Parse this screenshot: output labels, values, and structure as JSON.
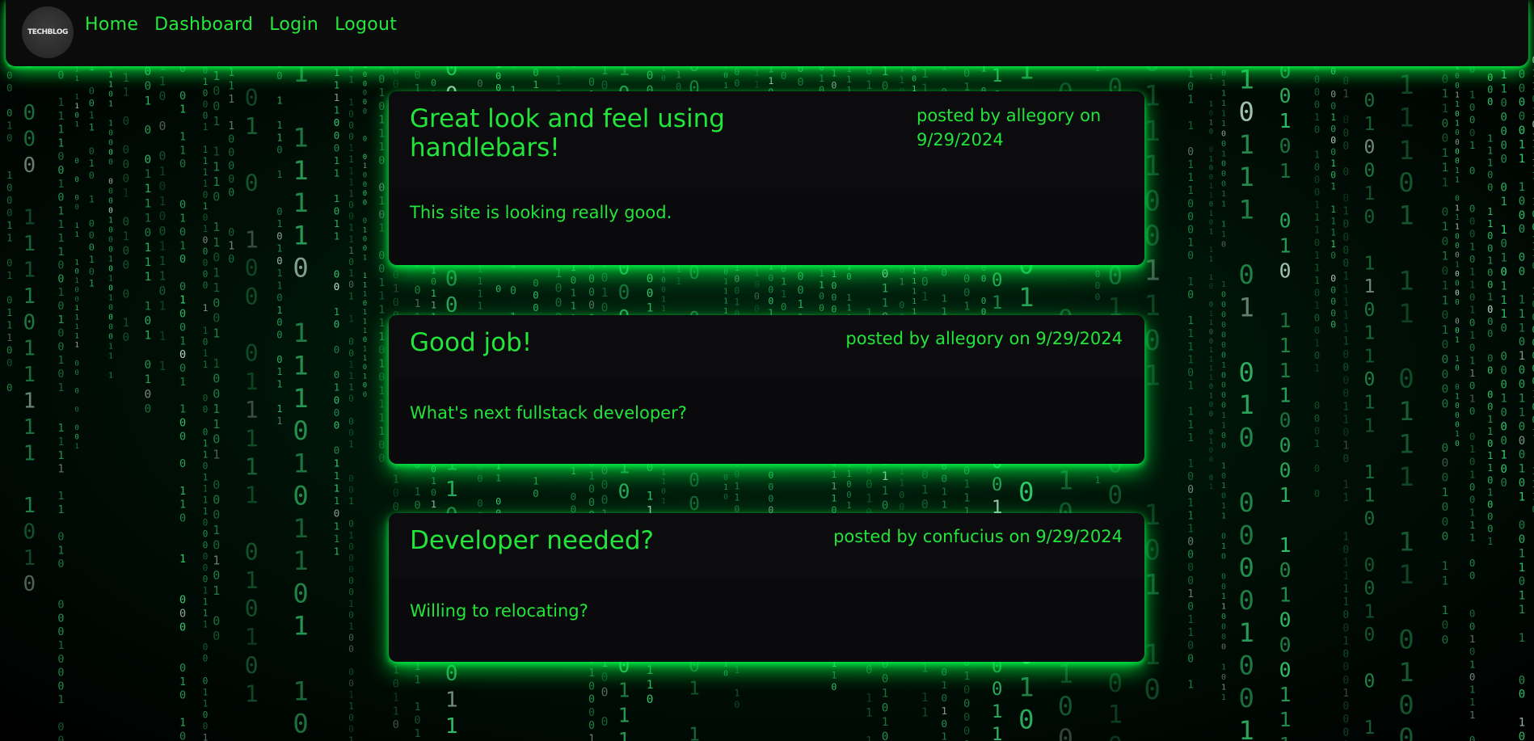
{
  "app": {
    "logo_text": "TECHBLOG"
  },
  "nav": {
    "links": [
      {
        "label": "Home"
      },
      {
        "label": "Dashboard"
      },
      {
        "label": "Login"
      },
      {
        "label": "Logout"
      }
    ]
  },
  "theme": {
    "accent": "#22e43a",
    "background": "#000000",
    "card": "#0a0a0c",
    "glow": "#00ff46"
  },
  "posts": [
    {
      "title": "Great look and feel using handlebars!",
      "meta": "posted by allegory on 9/29/2024",
      "body": "This site is looking really good."
    },
    {
      "title": "Good job!",
      "meta": "posted by allegory on 9/29/2024",
      "body": "What's next fullstack developer?"
    },
    {
      "title": "Developer needed?",
      "meta": "posted by confucius on 9/29/2024",
      "body": "Willing to relocating?"
    }
  ]
}
